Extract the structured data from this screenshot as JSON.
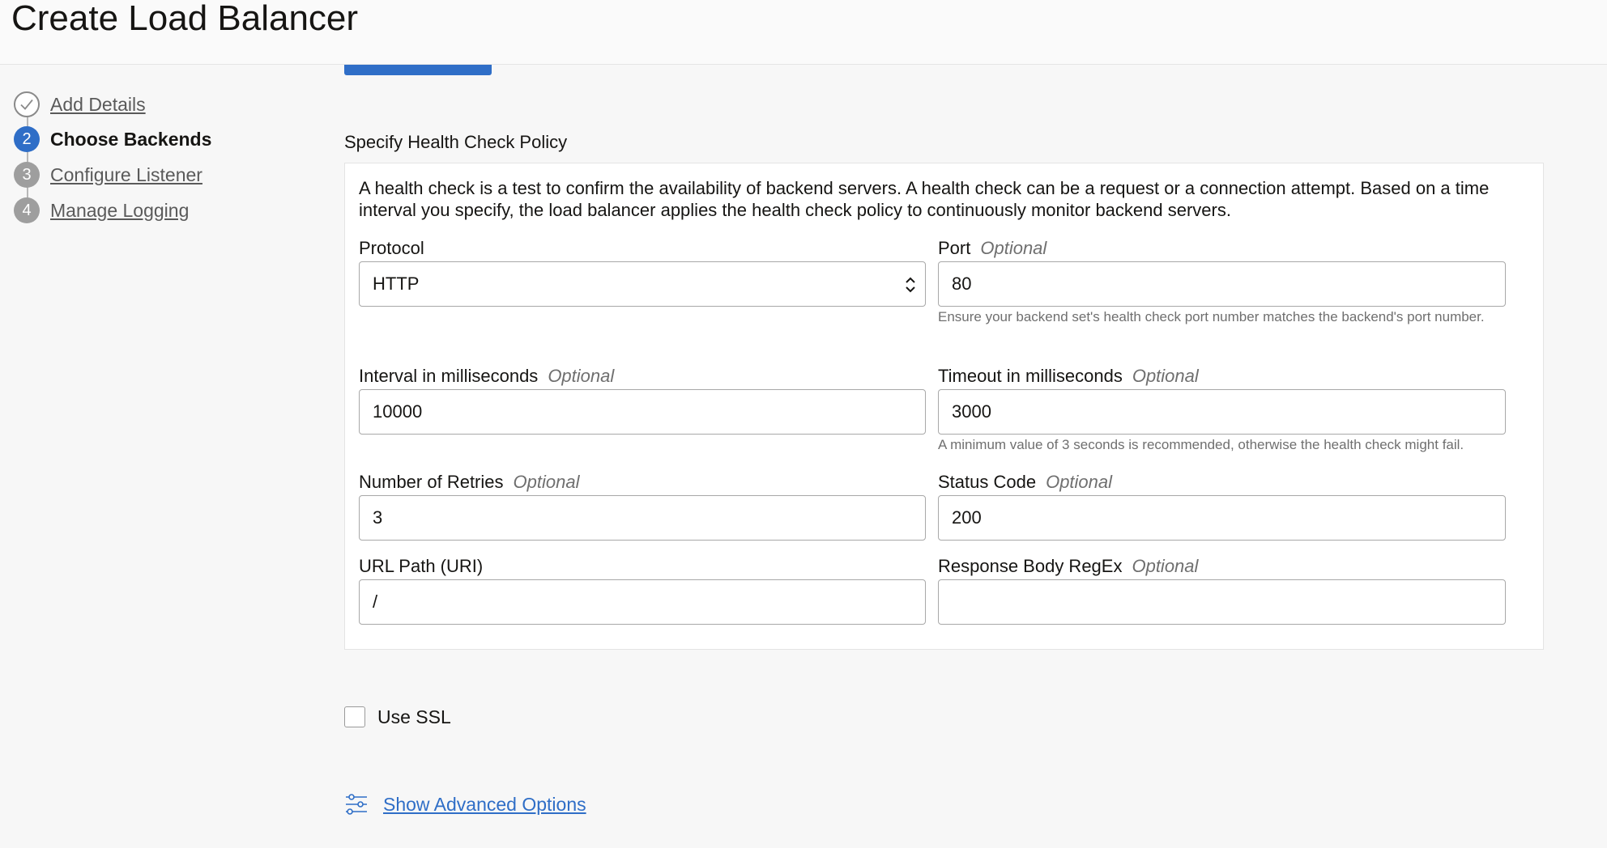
{
  "header": {
    "title": "Create Load Balancer"
  },
  "steps": [
    {
      "number": "",
      "label": "Add Details",
      "state": "done"
    },
    {
      "number": "2",
      "label": "Choose Backends",
      "state": "active"
    },
    {
      "number": "3",
      "label": "Configure Listener",
      "state": "pending"
    },
    {
      "number": "4",
      "label": "Manage Logging",
      "state": "pending"
    }
  ],
  "section": {
    "title": "Specify Health Check Policy",
    "description": "A health check is a test to confirm the availability of backend servers. A health check can be a request or a connection attempt. Based on a time interval you specify, the load balancer applies the health check policy to continuously monitor backend servers."
  },
  "fields": {
    "protocol": {
      "label": "Protocol",
      "value": "HTTP"
    },
    "port": {
      "label": "Port",
      "optional": "Optional",
      "value": "80",
      "hint": "Ensure your backend set's health check port number matches the backend's port number."
    },
    "interval": {
      "label": "Interval in milliseconds",
      "optional": "Optional",
      "value": "10000"
    },
    "timeout": {
      "label": "Timeout in milliseconds",
      "optional": "Optional",
      "value": "3000",
      "hint": "A minimum value of 3 seconds is recommended, otherwise the health check might fail."
    },
    "retries": {
      "label": "Number of Retries",
      "optional": "Optional",
      "value": "3"
    },
    "status_code": {
      "label": "Status Code",
      "optional": "Optional",
      "value": "200"
    },
    "url_path": {
      "label": "URL Path (URI)",
      "value": "/"
    },
    "regex": {
      "label": "Response Body RegEx",
      "optional": "Optional",
      "value": ""
    }
  },
  "ssl": {
    "label": "Use SSL",
    "checked": false
  },
  "advanced": {
    "label": "Show Advanced Options",
    "icon": "sliders-icon"
  },
  "colors": {
    "accent": "#2f6ec7",
    "step_pending": "#9e9e9e"
  }
}
